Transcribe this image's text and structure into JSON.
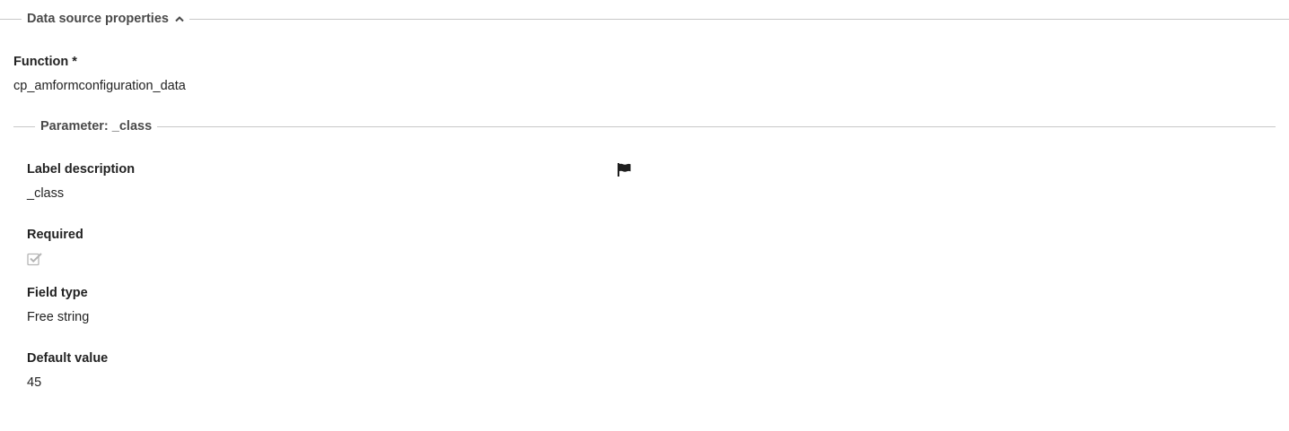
{
  "sections": {
    "datasource": {
      "legend": "Data source properties",
      "collapse_icon": "chevron-up-icon"
    },
    "parameter": {
      "legend": "Parameter: _class"
    }
  },
  "fields": {
    "function": {
      "label": "Function *",
      "value": "cp_amformconfiguration_data"
    },
    "label_description": {
      "label": "Label description",
      "value": "_class",
      "icon": "flag-icon"
    },
    "required": {
      "label": "Required",
      "checked": true,
      "disabled": true
    },
    "field_type": {
      "label": "Field type",
      "value": "Free string"
    },
    "default_value": {
      "label": "Default value",
      "value": "45"
    }
  },
  "colors": {
    "text": "#222222",
    "legend": "#4a4a4a",
    "divider": "#c8c8c8",
    "checkbox_disabled": "#b5b5b5"
  }
}
